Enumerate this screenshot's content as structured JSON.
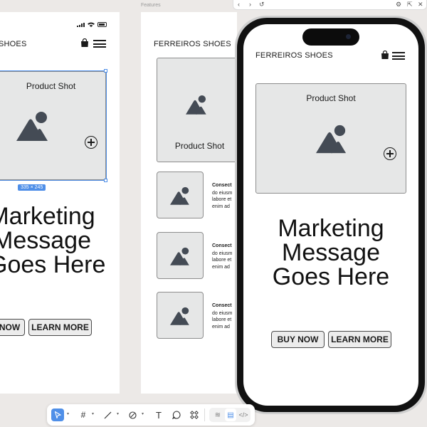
{
  "canvas": {
    "frame_label": "Features",
    "selection_size": "335 × 245"
  },
  "left_frame": {
    "brand": "SHOES",
    "product_label": "Product Shot",
    "marketing_lines": [
      "Marketing",
      "Message",
      "Goes Here"
    ],
    "buttons": {
      "buy": "NOW",
      "learn": "LEARN MORE"
    }
  },
  "mid_frame": {
    "brand": "FERREIROS SHOES",
    "product_label": "Product Shot",
    "features": [
      {
        "title": "Consect",
        "body": "do eiusm\nlabore et\nenim ad"
      },
      {
        "title": "Consect",
        "body": "do eiusm\nlabore et\nenim ad"
      },
      {
        "title": "Consect",
        "body": "do eiusm\nlabore et\nenim ad"
      }
    ]
  },
  "phone": {
    "brand": "FERREIROS SHOES",
    "product_label": "Product Shot",
    "marketing_lines": [
      "Marketing",
      "Message",
      "Goes Here"
    ],
    "buttons": {
      "buy": "BUY NOW",
      "learn": "LEARN MORE"
    }
  },
  "topbar": {
    "icons": [
      "back-arrow-icon",
      "forward-arrow-icon",
      "undo-icon",
      "inspect-icon",
      "external-link-icon",
      "close-icon"
    ]
  },
  "toolbar": {
    "tools": [
      "move-tool-icon",
      "frame-tool-icon",
      "line-tool-icon",
      "pen-tool-icon",
      "text-tool-icon",
      "comment-icon",
      "components-icon",
      "design-mode-icon",
      "prototype-mode-icon",
      "code-mode-icon"
    ]
  },
  "colors": {
    "selection": "#4f8fe8",
    "placeholder_fill": "#e6e7e7",
    "icon": "#444b55",
    "canvas": "#ece9e7"
  }
}
